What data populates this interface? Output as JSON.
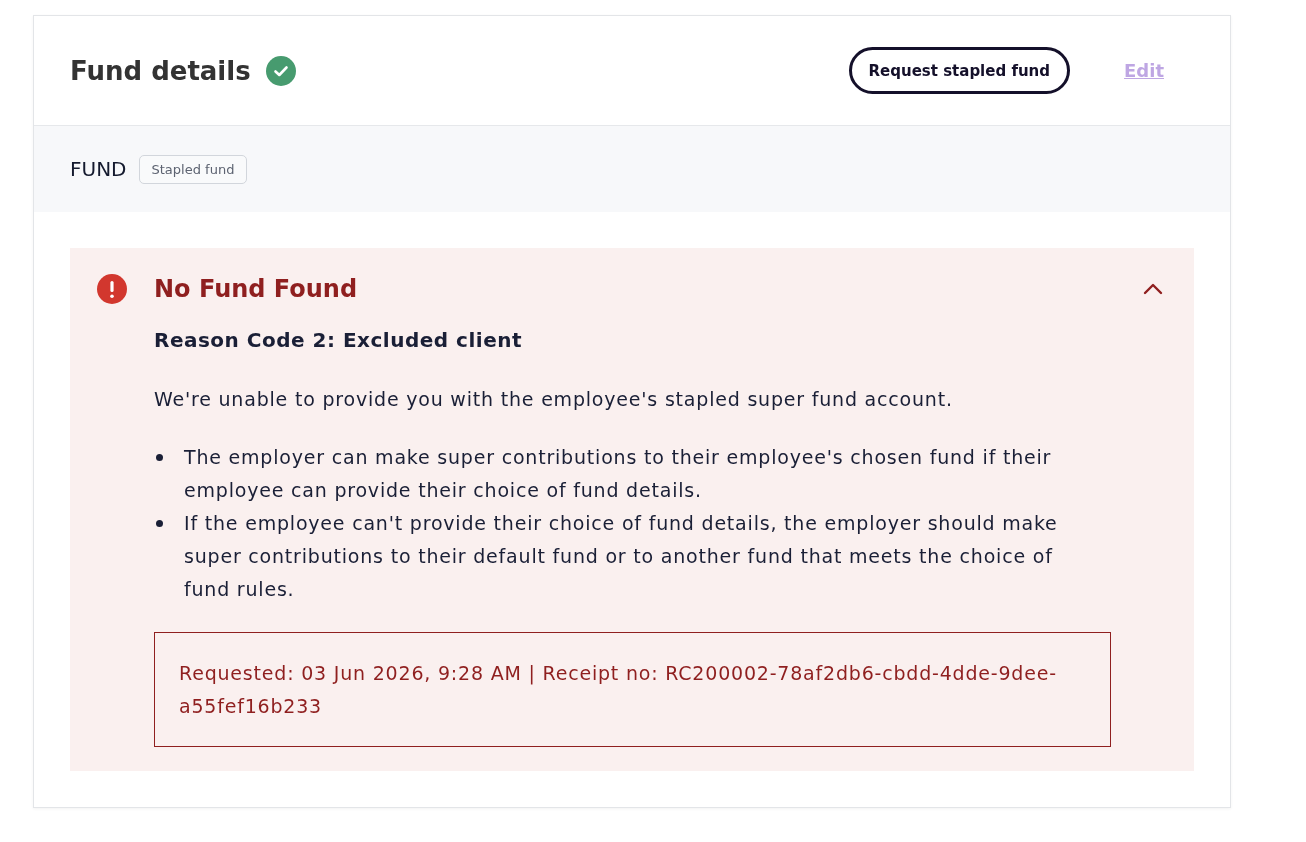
{
  "card": {
    "title": "Fund details",
    "complete": true,
    "request_button": "Request stapled fund",
    "edit_link": {
      "label": "Edit",
      "disabled": true
    }
  },
  "fund_section": {
    "label": "FUND",
    "tag": "Stapled fund"
  },
  "alert": {
    "kind": "error",
    "expanded": true,
    "title": "No Fund Found",
    "subtitle": "Reason Code 2: Excluded client",
    "message": "We're unable to provide you with the employee's stapled super fund account.",
    "bullets": [
      "The employer can make super contributions to their employee's chosen fund if their employee can provide their choice of fund details.",
      "If the employee can't provide their choice of fund details, the employer should make super contributions to their default fund or to another fund that meets the choice of fund rules."
    ],
    "receipt": "Requested: 03 Jun 2026, 9:28 AM | Receipt no: RC200002-78af2db6-cbdd-4dde-9dee-a55fef16b233"
  }
}
